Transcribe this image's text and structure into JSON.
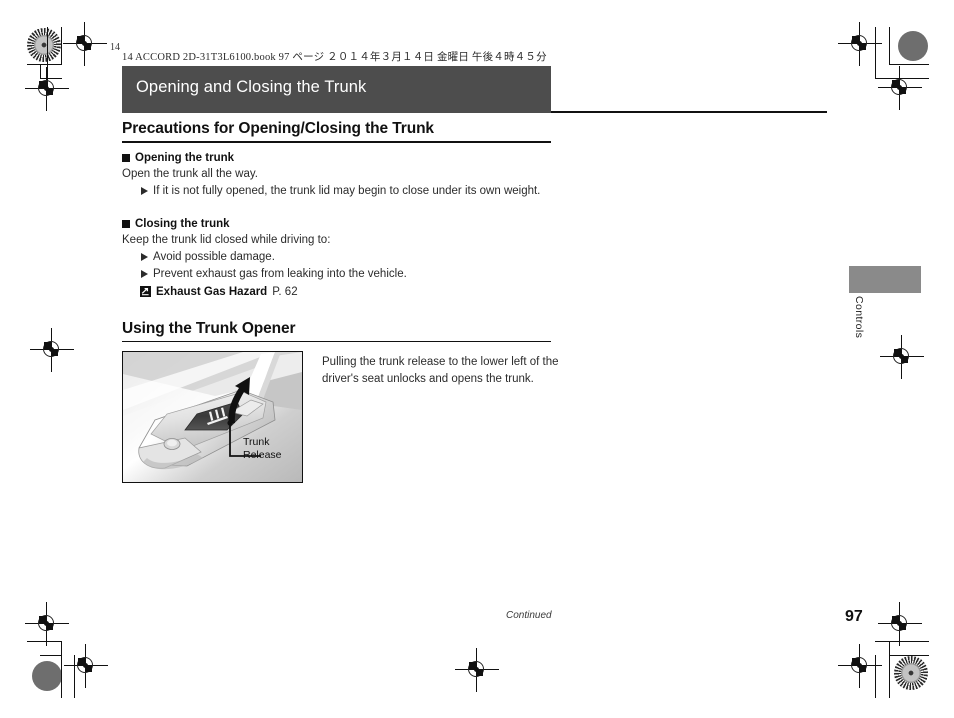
{
  "document": {
    "file_info_line": "14 ACCORD 2D-31T3L6100.book  97 ページ  ２０１４年３月１４日  金曜日  午後４時４５分",
    "chapter_title": "Opening and Closing the Trunk",
    "page_number": "97",
    "continued_label": "Continued",
    "side_tab_label": "Controls",
    "corner_mark_label": "14"
  },
  "sections": [
    {
      "heading": "Precautions for Opening/Closing the Trunk",
      "subsections": [
        {
          "subheading": "Opening the trunk",
          "lead": "Open the trunk all the way.",
          "bullets": [
            "If it is not fully opened, the trunk lid may begin to close under its own weight."
          ]
        },
        {
          "subheading": "Closing the trunk",
          "lead": "Keep the trunk lid closed while driving to:",
          "bullets": [
            "Avoid possible damage.",
            "Prevent exhaust gas from leaking into the vehicle."
          ],
          "cross_reference": {
            "title": "Exhaust Gas Hazard",
            "page": "P. 62"
          }
        }
      ]
    },
    {
      "heading": "Using the Trunk Opener",
      "figure": {
        "callout_line1": "Trunk",
        "callout_line2": "Release"
      },
      "body_text": "Pulling the trunk release to the lower left of the driver's seat unlocks and opens the trunk."
    }
  ],
  "colors": {
    "title_bar": "#4d4d4d",
    "side_tab": "#8a8a8a",
    "rule": "#111111",
    "body_text": "#2b2b2b"
  }
}
